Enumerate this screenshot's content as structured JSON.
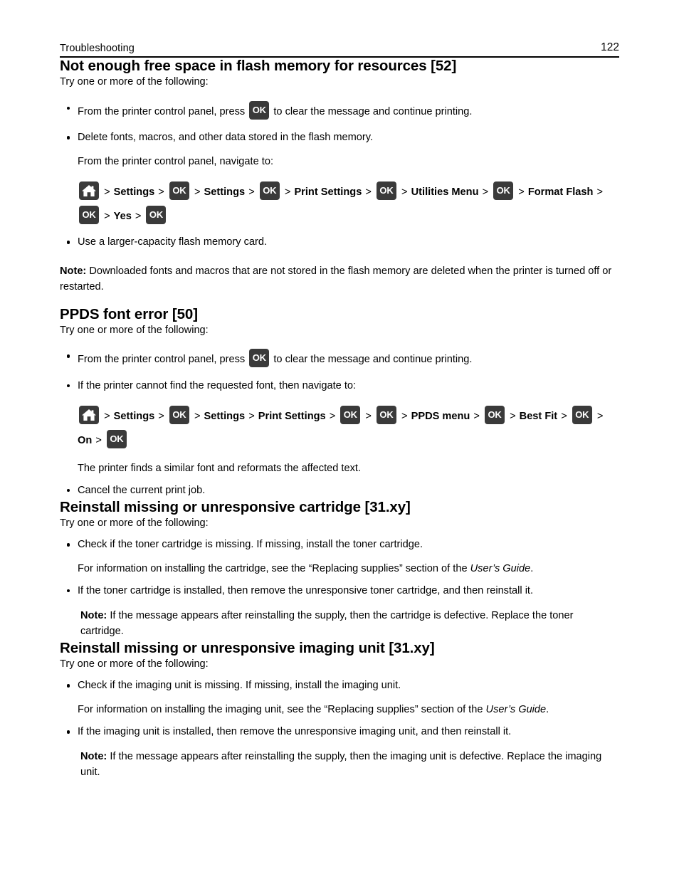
{
  "header": {
    "title": "Troubleshooting",
    "page_number": "122"
  },
  "icons": {
    "ok_label": "OK",
    "home_name": "home-icon",
    "separator": ">"
  },
  "sections": [
    {
      "heading": "Not enough free space in flash memory for resources [52]",
      "intro": "Try one or more of the following:",
      "bullet1": "From the printer control panel, press",
      "bullet1_tail": "to clear the message and continue printing.",
      "bullet2": "Delete fonts, macros, and other data stored in the flash memory.",
      "navigate_intro": "From the printer control panel, navigate to:",
      "path_line1": [
        "Settings",
        "Settings",
        "Print Settings",
        "Utilities Menu",
        "Format Flash"
      ],
      "path_line2": [
        "Yes"
      ],
      "bullet3": "Use a larger-capacity flash memory card.",
      "note_label": "Note:",
      "note_text": "Downloaded fonts and macros that are not stored in the flash memory are deleted when the printer is turned off or restarted."
    },
    {
      "heading": "PPDS font error [50]",
      "intro": "Try one or more of the following:",
      "bullet1": "From the printer control panel, press",
      "bullet1_tail": "to clear the message and continue printing.",
      "bullet2": "If the printer cannot find the requested font, then navigate to:",
      "path_segments": [
        "Settings",
        "Settings",
        "Print Settings",
        "PPDS menu",
        "Best Fit",
        "On"
      ],
      "after_path": "The printer finds a similar font and reformats the affected text.",
      "bullet3": "Cancel the current print job."
    },
    {
      "heading": "Reinstall missing or unresponsive cartridge [31.xy]",
      "intro": "Try one or more of the following:",
      "bullet1": "Check if the toner cartridge is missing. If missing, install the toner cartridge.",
      "sub1_pre": "For information on installing the cartridge, see the “Replacing supplies” section of the ",
      "sub1_italic": "User’s Guide",
      "sub1_post": ".",
      "bullet2": "If the toner cartridge is installed, then remove the unresponsive toner cartridge, and then reinstall it.",
      "note_label": "Note:",
      "note_text": "If the message appears after reinstalling the supply, then the cartridge is defective. Replace the toner cartridge."
    },
    {
      "heading": "Reinstall missing or unresponsive imaging unit [31.xy]",
      "intro": "Try one or more of the following:",
      "bullet1": "Check if the imaging unit is missing. If missing, install the imaging unit.",
      "sub1_pre": "For information on installing the imaging unit, see the “Replacing supplies” section of the ",
      "sub1_italic": "User’s Guide",
      "sub1_post": ".",
      "bullet2": "If the imaging unit is installed, then remove the unresponsive imaging unit, and then reinstall it.",
      "note_label": "Note:",
      "note_text": "If the message appears after reinstalling the supply, then the imaging unit is defective. Replace the imaging unit."
    }
  ]
}
